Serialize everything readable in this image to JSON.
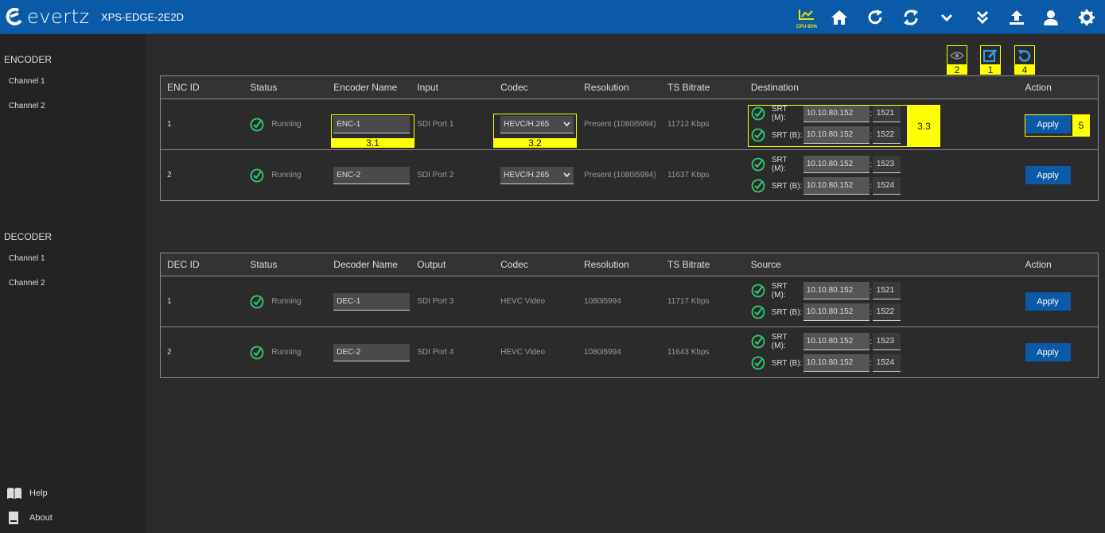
{
  "header": {
    "logo_text": "evertz",
    "device_name": "XPS-EDGE-2E2D",
    "cpu_label": "CPU 85%",
    "icons": [
      "cpu-chart-icon",
      "home-icon",
      "refresh-icon",
      "sync-icon",
      "chevron-down-icon",
      "double-chevron-down-icon",
      "upload-icon",
      "user-icon",
      "settings-gear-icon"
    ]
  },
  "sidebar": {
    "encoder_title": "ENCODER",
    "encoder_items": [
      "Channel 1",
      "Channel 2"
    ],
    "decoder_title": "DECODER",
    "decoder_items": [
      "Channel 1",
      "Channel 2"
    ],
    "help": "Help",
    "about": "About"
  },
  "annotations": {
    "eye": "2",
    "edit": "1",
    "reset": "4",
    "enc_name": "3.1",
    "codec": "3.2",
    "destination": "3.3",
    "apply": "5"
  },
  "encoder_table": {
    "headers": [
      "ENC ID",
      "Status",
      "Encoder Name",
      "Input",
      "Codec",
      "Resolution",
      "TS Bitrate",
      "Destination",
      "Action"
    ],
    "rows": [
      {
        "id": "1",
        "status": "Running",
        "name": "ENC-1",
        "input": "SDI Port 1",
        "codec": "HEVC/H.265",
        "resolution": "Present (1080i5994)",
        "bitrate": "11712 Kbps",
        "dest": [
          {
            "label": "SRT (M):",
            "ip": "10.10.80.152",
            "port": "1521"
          },
          {
            "label": "SRT (B):",
            "ip": "10.10.80.152",
            "port": "1522"
          }
        ],
        "action": "Apply"
      },
      {
        "id": "2",
        "status": "Running",
        "name": "ENC-2",
        "input": "SDI Port 2",
        "codec": "HEVC/H.265",
        "resolution": "Present (1080i5994)",
        "bitrate": "11637 Kbps",
        "dest": [
          {
            "label": "SRT (M):",
            "ip": "10.10.80.152",
            "port": "1523"
          },
          {
            "label": "SRT (B):",
            "ip": "10.10.80.152",
            "port": "1524"
          }
        ],
        "action": "Apply"
      }
    ]
  },
  "decoder_table": {
    "headers": [
      "DEC ID",
      "Status",
      "Decoder Name",
      "Output",
      "Codec",
      "Resolution",
      "TS Bitrate",
      "Source",
      "Action"
    ],
    "rows": [
      {
        "id": "1",
        "status": "Running",
        "name": "DEC-1",
        "output": "SDI Port 3",
        "codec": "HEVC Video",
        "resolution": "1080i5994",
        "bitrate": "11717 Kbps",
        "src": [
          {
            "label": "SRT (M):",
            "ip": "10.10.80.152",
            "port": "1521"
          },
          {
            "label": "SRT (B):",
            "ip": "10.10.80.152",
            "port": "1522"
          }
        ],
        "action": "Apply"
      },
      {
        "id": "2",
        "status": "Running",
        "name": "DEC-2",
        "output": "SDI Port 4",
        "codec": "HEVC Video",
        "resolution": "1080i5994",
        "bitrate": "11643 Kbps",
        "src": [
          {
            "label": "SRT (M):",
            "ip": "10.10.80.152",
            "port": "1523"
          },
          {
            "label": "SRT (B):",
            "ip": "10.10.80.152",
            "port": "1524"
          }
        ],
        "action": "Apply"
      }
    ]
  },
  "colors": {
    "brand_blue": "#0b5aa8",
    "running_green": "#2ecc71",
    "highlight_yellow": "#ffff00"
  }
}
